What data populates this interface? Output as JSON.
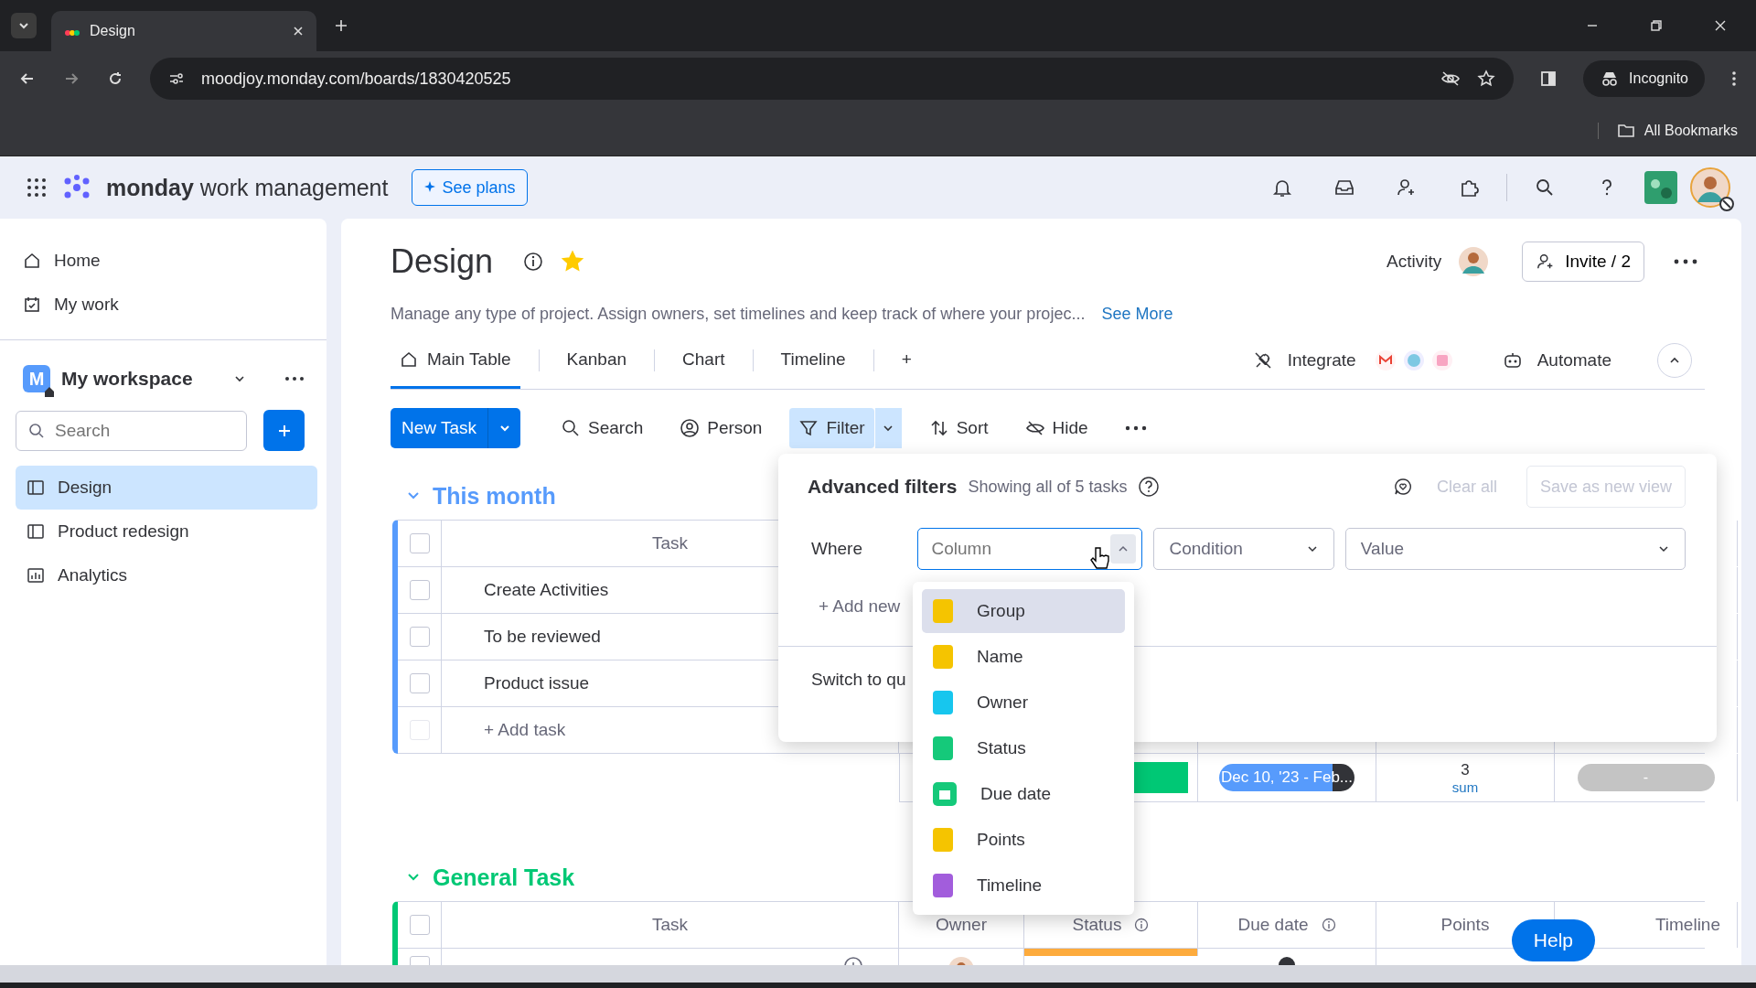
{
  "browser": {
    "tab_title": "Design",
    "url": "moodjoy.monday.com/boards/1830420525",
    "profile": "Incognito",
    "bookmarks": "All Bookmarks"
  },
  "app_header": {
    "logo_bold": "monday",
    "logo_rest": "work management",
    "see_plans": "See plans"
  },
  "sidebar": {
    "nav": [
      {
        "label": "Home",
        "kind": "home"
      },
      {
        "label": "My work",
        "kind": "work"
      }
    ],
    "workspace": {
      "initial": "M",
      "name": "My workspace"
    },
    "search": {
      "placeholder": "Search"
    },
    "boards": [
      {
        "label": "Design",
        "kind": "board",
        "selected": true
      },
      {
        "label": "Product redesign",
        "kind": "board",
        "selected": false
      },
      {
        "label": "Analytics",
        "kind": "dashboard",
        "selected": false
      }
    ]
  },
  "board": {
    "title": "Design",
    "favorite": true,
    "description": "Manage any type of project. Assign owners, set timelines and keep track of where your projec...",
    "see_more": "See More",
    "activity": "Activity",
    "invite": "Invite / 2",
    "views": [
      {
        "label": "Main Table",
        "selected": true
      },
      {
        "label": "Kanban",
        "selected": false
      },
      {
        "label": "Chart",
        "selected": false
      },
      {
        "label": "Timeline",
        "selected": false
      }
    ],
    "add_view": "+",
    "integrate": "Integrate",
    "automate": "Automate"
  },
  "toolbar": {
    "new_item": "New Task",
    "tools": [
      {
        "label": "Search",
        "kind": "search",
        "selected": false
      },
      {
        "label": "Person",
        "kind": "person",
        "selected": false
      },
      {
        "label": "Filter",
        "kind": "filter",
        "selected": true
      },
      {
        "label": "Sort",
        "kind": "sort",
        "selected": false
      },
      {
        "label": "Hide",
        "kind": "hide",
        "selected": false
      }
    ]
  },
  "filter_panel": {
    "title": "Advanced filters",
    "summary": "Showing all of 5 tasks",
    "clear_all": "Clear all",
    "save_view": "Save as new view",
    "where": "Where",
    "column": {
      "placeholder": "Column"
    },
    "condition": "Condition",
    "value": "Value",
    "add_filter": "+ Add new",
    "switch": "Switch to qu",
    "options": [
      {
        "label": "Group",
        "color": "#f5c400",
        "kind": "square",
        "selected": true
      },
      {
        "label": "Name",
        "color": "#f5c400",
        "kind": "square",
        "selected": false
      },
      {
        "label": "Owner",
        "color": "#17c6ee",
        "kind": "square",
        "selected": false
      },
      {
        "label": "Status",
        "color": "#15c97a",
        "kind": "square",
        "selected": false
      },
      {
        "label": "Due date",
        "color": "#15c97a",
        "kind": "date",
        "selected": false
      },
      {
        "label": "Points",
        "color": "#f5c400",
        "kind": "square",
        "selected": false
      },
      {
        "label": "Timeline",
        "color": "#a25ddc",
        "kind": "square",
        "selected": false
      }
    ]
  },
  "groups": [
    {
      "name": "This month",
      "color": "#579bfc",
      "columns": [
        "Task"
      ],
      "select_all": {
        "checked": false
      },
      "rows": [
        {
          "task": "Create Activities",
          "checked": false
        },
        {
          "task": "To be reviewed",
          "checked": false
        },
        {
          "task": "Product issue",
          "checked": false
        }
      ],
      "add_task": "+ Add task",
      "summary": {
        "date": "Dec 10, '23 - Feb...",
        "points": "3",
        "points_label": "sum",
        "timeline": "-"
      }
    },
    {
      "name": "General Task",
      "color": "#00c875",
      "columns": [
        "Task",
        "Owner",
        "Status",
        "Due date",
        "Points",
        "Timeline"
      ],
      "select_all": {
        "checked": false
      }
    }
  ],
  "help": "Help"
}
